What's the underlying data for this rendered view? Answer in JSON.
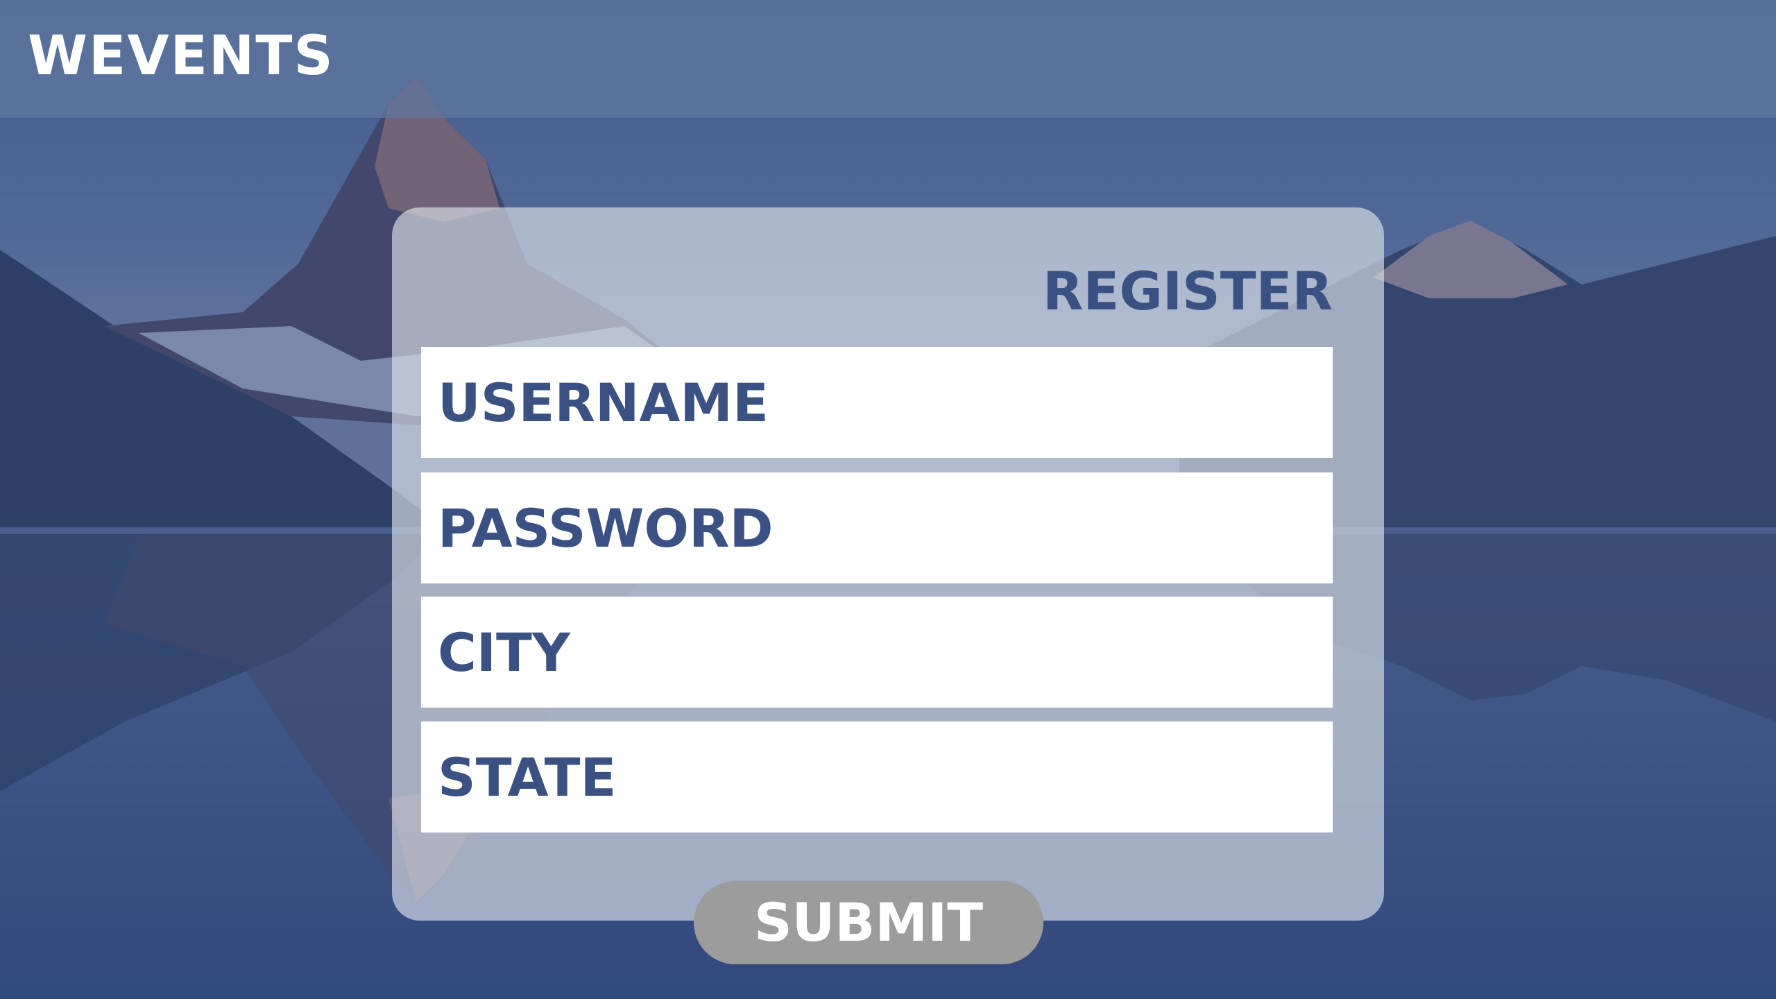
{
  "header": {
    "brand": "WEVENTS"
  },
  "form": {
    "title": "REGISTER",
    "fields": [
      {
        "placeholder": "USERNAME",
        "value": ""
      },
      {
        "placeholder": "PASSWORD",
        "value": ""
      },
      {
        "placeholder": "CITY",
        "value": ""
      },
      {
        "placeholder": "STATE",
        "value": ""
      }
    ],
    "submit_label": "SUBMIT"
  },
  "colors": {
    "accent": "#3a5283",
    "overlay_blue": "#3d5585",
    "button_gray": "#9c9c9c",
    "card_tint": "#dae0e8"
  },
  "background": {
    "image": "mountain-lake-reflection"
  }
}
